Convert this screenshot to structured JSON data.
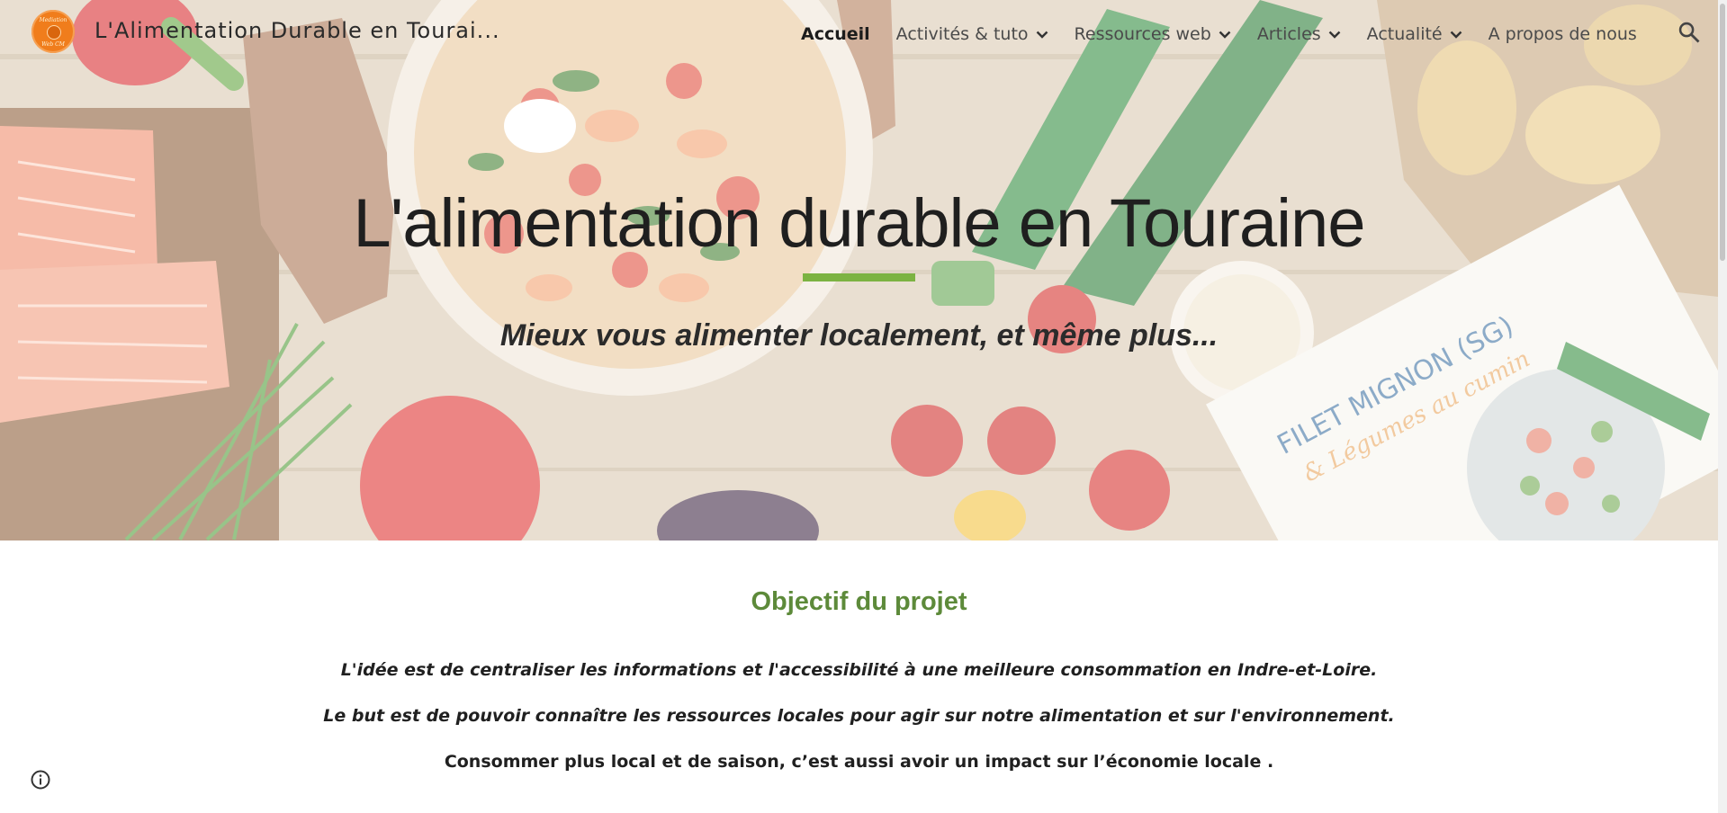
{
  "header": {
    "logo_text_top": "Mediation",
    "logo_text_bottom": "Web CM",
    "site_title": "L'Alimentation Durable en Tourai...",
    "nav": [
      {
        "label": "Accueil",
        "dropdown": false,
        "active": true
      },
      {
        "label": "Activités & tuto",
        "dropdown": true,
        "active": false
      },
      {
        "label": "Ressources web",
        "dropdown": true,
        "active": false
      },
      {
        "label": "Articles",
        "dropdown": true,
        "active": false
      },
      {
        "label": "Actualité",
        "dropdown": true,
        "active": false
      },
      {
        "label": "A propos de nous",
        "dropdown": false,
        "active": false
      }
    ],
    "search_icon": "search-icon"
  },
  "hero": {
    "title": "L'alimentation durable en Touraine",
    "subtitle": "Mieux vous alimenter localement, et même plus...",
    "accent_color": "#7cb342",
    "card_text": "FILET MIGNON (SG)",
    "card_subtext": "& Légumes au cumin"
  },
  "content": {
    "heading": "Objectif du projet",
    "heading_color": "#5d8a3a",
    "paragraphs": [
      "L'idée est de centraliser les informations et l'accessibilité à une meilleure consommation en Indre-et-Loire.",
      "Le but est de pouvoir connaître les ressources locales pour agir sur notre alimentation et sur l'environnement.",
      "Consommer plus local et de saison, c’est aussi avoir un impact sur l’économie locale ."
    ]
  },
  "footer": {
    "info_icon": "info-icon"
  }
}
